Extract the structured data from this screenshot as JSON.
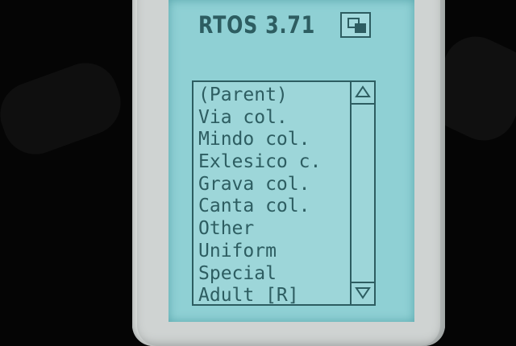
{
  "device": {
    "title": "RTOS 3.71"
  },
  "window_button": {
    "icon": "window-restore-icon"
  },
  "list": {
    "items": [
      "(Parent)",
      "Via col.",
      "Mindo col.",
      "Exlesico c.",
      "Grava col.",
      "Canta col.",
      "Other",
      "Uniform",
      "Special",
      "Adult [R]"
    ]
  },
  "scrollbar": {
    "up_icon": "triangle-up-icon",
    "down_icon": "triangle-down-icon"
  },
  "colors": {
    "screen": "#8fd0d4",
    "ink": "#2d5d61",
    "casing": "#cfd3d2"
  }
}
